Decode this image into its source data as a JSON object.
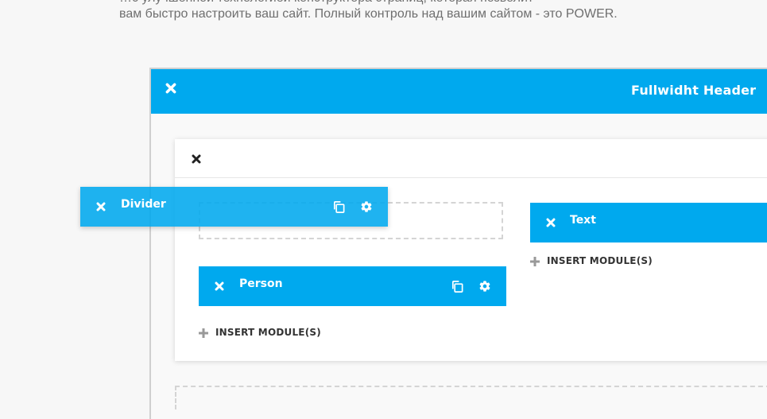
{
  "intro": {
    "line1": "…с улучшенной технологией конструктора страниц, которая позволит",
    "line2": "вам быстро настроить ваш сайт. Полный контроль над вашим сайтом - это POWER."
  },
  "section": {
    "title": "Fullwidht Header"
  },
  "modules": {
    "divider": {
      "label": "Divider"
    },
    "person": {
      "label": "Person"
    },
    "text": {
      "label": "Text"
    }
  },
  "insert_label": "INSERT MODULE(S)",
  "colors": {
    "accent": "#00a9ee",
    "text_dark": "#333333",
    "intro_gray": "#6f6f6f"
  },
  "icons": [
    "close-icon",
    "copy-icon",
    "gear-icon",
    "plus-icon"
  ]
}
